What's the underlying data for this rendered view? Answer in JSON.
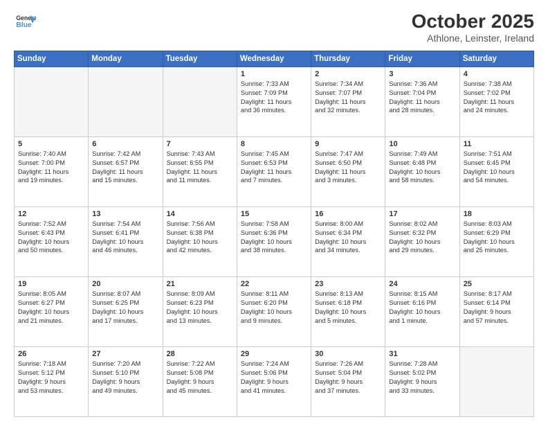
{
  "header": {
    "logo_line1": "General",
    "logo_line2": "Blue",
    "title": "October 2025",
    "subtitle": "Athlone, Leinster, Ireland"
  },
  "weekdays": [
    "Sunday",
    "Monday",
    "Tuesday",
    "Wednesday",
    "Thursday",
    "Friday",
    "Saturday"
  ],
  "weeks": [
    [
      {
        "day": "",
        "info": ""
      },
      {
        "day": "",
        "info": ""
      },
      {
        "day": "",
        "info": ""
      },
      {
        "day": "1",
        "info": "Sunrise: 7:33 AM\nSunset: 7:09 PM\nDaylight: 11 hours\nand 36 minutes."
      },
      {
        "day": "2",
        "info": "Sunrise: 7:34 AM\nSunset: 7:07 PM\nDaylight: 11 hours\nand 32 minutes."
      },
      {
        "day": "3",
        "info": "Sunrise: 7:36 AM\nSunset: 7:04 PM\nDaylight: 11 hours\nand 28 minutes."
      },
      {
        "day": "4",
        "info": "Sunrise: 7:38 AM\nSunset: 7:02 PM\nDaylight: 11 hours\nand 24 minutes."
      }
    ],
    [
      {
        "day": "5",
        "info": "Sunrise: 7:40 AM\nSunset: 7:00 PM\nDaylight: 11 hours\nand 19 minutes."
      },
      {
        "day": "6",
        "info": "Sunrise: 7:42 AM\nSunset: 6:57 PM\nDaylight: 11 hours\nand 15 minutes."
      },
      {
        "day": "7",
        "info": "Sunrise: 7:43 AM\nSunset: 6:55 PM\nDaylight: 11 hours\nand 11 minutes."
      },
      {
        "day": "8",
        "info": "Sunrise: 7:45 AM\nSunset: 6:53 PM\nDaylight: 11 hours\nand 7 minutes."
      },
      {
        "day": "9",
        "info": "Sunrise: 7:47 AM\nSunset: 6:50 PM\nDaylight: 11 hours\nand 3 minutes."
      },
      {
        "day": "10",
        "info": "Sunrise: 7:49 AM\nSunset: 6:48 PM\nDaylight: 10 hours\nand 58 minutes."
      },
      {
        "day": "11",
        "info": "Sunrise: 7:51 AM\nSunset: 6:45 PM\nDaylight: 10 hours\nand 54 minutes."
      }
    ],
    [
      {
        "day": "12",
        "info": "Sunrise: 7:52 AM\nSunset: 6:43 PM\nDaylight: 10 hours\nand 50 minutes."
      },
      {
        "day": "13",
        "info": "Sunrise: 7:54 AM\nSunset: 6:41 PM\nDaylight: 10 hours\nand 46 minutes."
      },
      {
        "day": "14",
        "info": "Sunrise: 7:56 AM\nSunset: 6:38 PM\nDaylight: 10 hours\nand 42 minutes."
      },
      {
        "day": "15",
        "info": "Sunrise: 7:58 AM\nSunset: 6:36 PM\nDaylight: 10 hours\nand 38 minutes."
      },
      {
        "day": "16",
        "info": "Sunrise: 8:00 AM\nSunset: 6:34 PM\nDaylight: 10 hours\nand 34 minutes."
      },
      {
        "day": "17",
        "info": "Sunrise: 8:02 AM\nSunset: 6:32 PM\nDaylight: 10 hours\nand 29 minutes."
      },
      {
        "day": "18",
        "info": "Sunrise: 8:03 AM\nSunset: 6:29 PM\nDaylight: 10 hours\nand 25 minutes."
      }
    ],
    [
      {
        "day": "19",
        "info": "Sunrise: 8:05 AM\nSunset: 6:27 PM\nDaylight: 10 hours\nand 21 minutes."
      },
      {
        "day": "20",
        "info": "Sunrise: 8:07 AM\nSunset: 6:25 PM\nDaylight: 10 hours\nand 17 minutes."
      },
      {
        "day": "21",
        "info": "Sunrise: 8:09 AM\nSunset: 6:23 PM\nDaylight: 10 hours\nand 13 minutes."
      },
      {
        "day": "22",
        "info": "Sunrise: 8:11 AM\nSunset: 6:20 PM\nDaylight: 10 hours\nand 9 minutes."
      },
      {
        "day": "23",
        "info": "Sunrise: 8:13 AM\nSunset: 6:18 PM\nDaylight: 10 hours\nand 5 minutes."
      },
      {
        "day": "24",
        "info": "Sunrise: 8:15 AM\nSunset: 6:16 PM\nDaylight: 10 hours\nand 1 minute."
      },
      {
        "day": "25",
        "info": "Sunrise: 8:17 AM\nSunset: 6:14 PM\nDaylight: 9 hours\nand 57 minutes."
      }
    ],
    [
      {
        "day": "26",
        "info": "Sunrise: 7:18 AM\nSunset: 5:12 PM\nDaylight: 9 hours\nand 53 minutes."
      },
      {
        "day": "27",
        "info": "Sunrise: 7:20 AM\nSunset: 5:10 PM\nDaylight: 9 hours\nand 49 minutes."
      },
      {
        "day": "28",
        "info": "Sunrise: 7:22 AM\nSunset: 5:08 PM\nDaylight: 9 hours\nand 45 minutes."
      },
      {
        "day": "29",
        "info": "Sunrise: 7:24 AM\nSunset: 5:06 PM\nDaylight: 9 hours\nand 41 minutes."
      },
      {
        "day": "30",
        "info": "Sunrise: 7:26 AM\nSunset: 5:04 PM\nDaylight: 9 hours\nand 37 minutes."
      },
      {
        "day": "31",
        "info": "Sunrise: 7:28 AM\nSunset: 5:02 PM\nDaylight: 9 hours\nand 33 minutes."
      },
      {
        "day": "",
        "info": ""
      }
    ]
  ]
}
